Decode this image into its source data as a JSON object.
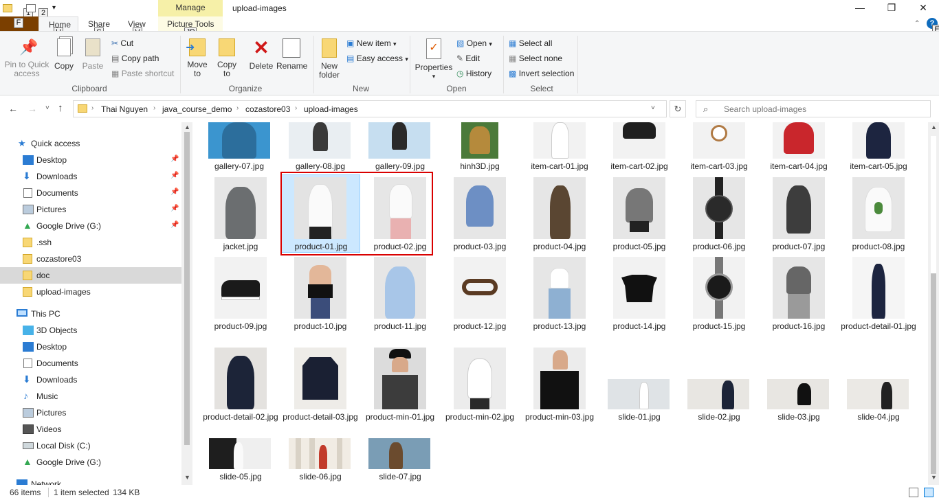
{
  "window": {
    "title": "upload-images",
    "manage_tab": "Manage",
    "picture_tools": "Picture Tools",
    "help": "?"
  },
  "keytips": {
    "qat1": "1",
    "qat2": "2",
    "file": "F",
    "home": "H",
    "share": "S",
    "view": "V",
    "picture_tools": "JP",
    "help": "E"
  },
  "tabs": {
    "file": "",
    "home": "Home",
    "share": "Share",
    "view": "View"
  },
  "ribbon": {
    "clipboard": {
      "label": "Clipboard",
      "pin": "Pin to Quick access",
      "copy": "Copy",
      "paste": "Paste",
      "cut": "Cut",
      "copy_path": "Copy path",
      "paste_shortcut": "Paste shortcut"
    },
    "organize": {
      "label": "Organize",
      "move_to": "Move to",
      "copy_to": "Copy to",
      "delete": "Delete",
      "rename": "Rename"
    },
    "new": {
      "label": "New",
      "new_folder": "New folder",
      "new_item": "New item",
      "easy_access": "Easy access"
    },
    "open": {
      "label": "Open",
      "properties": "Properties",
      "open": "Open",
      "edit": "Edit",
      "history": "History"
    },
    "select": {
      "label": "Select",
      "select_all": "Select all",
      "select_none": "Select none",
      "invert": "Invert selection"
    }
  },
  "address": {
    "crumbs": [
      "Thai Nguyen",
      "java_course_demo",
      "cozastore03",
      "upload-images"
    ],
    "search_placeholder": "Search upload-images"
  },
  "nav": {
    "quick_access": "Quick access",
    "items": [
      "Desktop",
      "Downloads",
      "Documents",
      "Pictures",
      "Google Drive (G:)",
      ".ssh",
      "cozastore03",
      "doc",
      "upload-images"
    ],
    "this_pc": "This PC",
    "pc_items": [
      "3D Objects",
      "Desktop",
      "Documents",
      "Downloads",
      "Music",
      "Pictures",
      "Videos",
      "Local Disk (C:)",
      "Google Drive (G:)",
      "Network"
    ]
  },
  "files": {
    "row1": [
      "gallery-07.jpg",
      "gallery-08.jpg",
      "gallery-09.jpg",
      "hinh3D.jpg",
      "item-cart-01.jpg",
      "item-cart-02.jpg",
      "item-cart-03.jpg",
      "item-cart-04.jpg",
      "item-cart-05.jpg"
    ],
    "row2": [
      "jacket.jpg",
      "product-01.jpg",
      "product-02.jpg",
      "product-03.jpg",
      "product-04.jpg",
      "product-05.jpg",
      "product-06.jpg",
      "product-07.jpg",
      "product-08.jpg"
    ],
    "row3": [
      "product-09.jpg",
      "product-10.jpg",
      "product-11.jpg",
      "product-12.jpg",
      "product-13.jpg",
      "product-14.jpg",
      "product-15.jpg",
      "product-16.jpg",
      "product-detail-01.jpg"
    ],
    "row4": [
      "product-detail-02.jpg",
      "product-detail-03.jpg",
      "product-min-01.jpg",
      "product-min-02.jpg",
      "product-min-03.jpg",
      "slide-01.jpg",
      "slide-02.jpg",
      "slide-03.jpg",
      "slide-04.jpg"
    ],
    "row5": [
      "slide-05.jpg",
      "slide-06.jpg",
      "slide-07.jpg"
    ]
  },
  "status": {
    "count": "66 items",
    "selected": "1 item selected",
    "size": "134 KB"
  },
  "colors": {
    "accent": "#0078d7",
    "selection": "#cce8ff",
    "highlight_box": "#d90000",
    "file_tab": "#7b3f00",
    "manage": "#f6f0a8"
  }
}
